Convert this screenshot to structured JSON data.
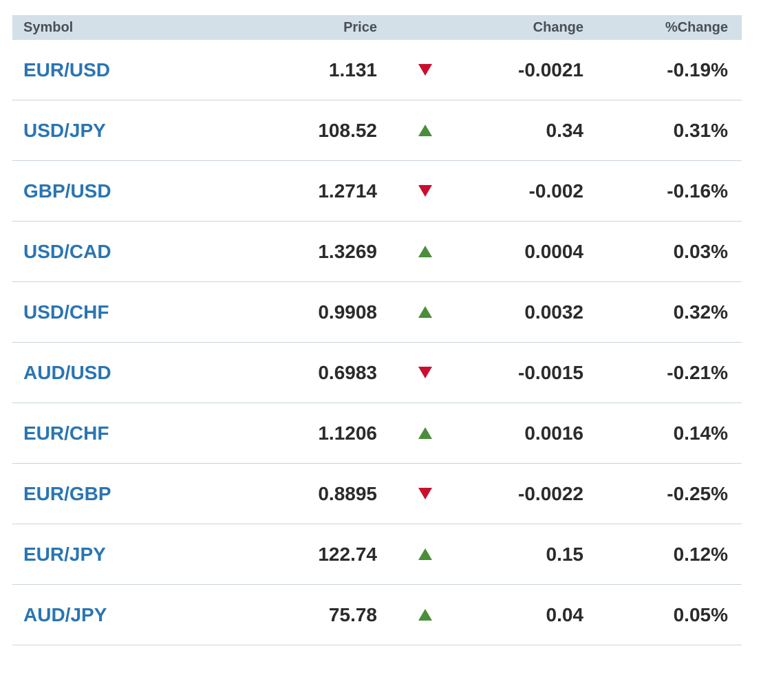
{
  "header": {
    "symbol": "Symbol",
    "price": "Price",
    "change": "Change",
    "pct_change": "%Change"
  },
  "colors": {
    "symbol_link": "#2a75b3",
    "down_arrow": "#c8102e",
    "up_arrow": "#4a8d3b",
    "header_bg": "#d3e0e8"
  },
  "rows": [
    {
      "symbol": "EUR/USD",
      "price": "1.131",
      "direction": "down",
      "change": "-0.0021",
      "pct": "-0.19%"
    },
    {
      "symbol": "USD/JPY",
      "price": "108.52",
      "direction": "up",
      "change": "0.34",
      "pct": "0.31%"
    },
    {
      "symbol": "GBP/USD",
      "price": "1.2714",
      "direction": "down",
      "change": "-0.002",
      "pct": "-0.16%"
    },
    {
      "symbol": "USD/CAD",
      "price": "1.3269",
      "direction": "up",
      "change": "0.0004",
      "pct": "0.03%"
    },
    {
      "symbol": "USD/CHF",
      "price": "0.9908",
      "direction": "up",
      "change": "0.0032",
      "pct": "0.32%"
    },
    {
      "symbol": "AUD/USD",
      "price": "0.6983",
      "direction": "down",
      "change": "-0.0015",
      "pct": "-0.21%"
    },
    {
      "symbol": "EUR/CHF",
      "price": "1.1206",
      "direction": "up",
      "change": "0.0016",
      "pct": "0.14%"
    },
    {
      "symbol": "EUR/GBP",
      "price": "0.8895",
      "direction": "down",
      "change": "-0.0022",
      "pct": "-0.25%"
    },
    {
      "symbol": "EUR/JPY",
      "price": "122.74",
      "direction": "up",
      "change": "0.15",
      "pct": "0.12%"
    },
    {
      "symbol": "AUD/JPY",
      "price": "75.78",
      "direction": "up",
      "change": "0.04",
      "pct": "0.05%"
    }
  ]
}
